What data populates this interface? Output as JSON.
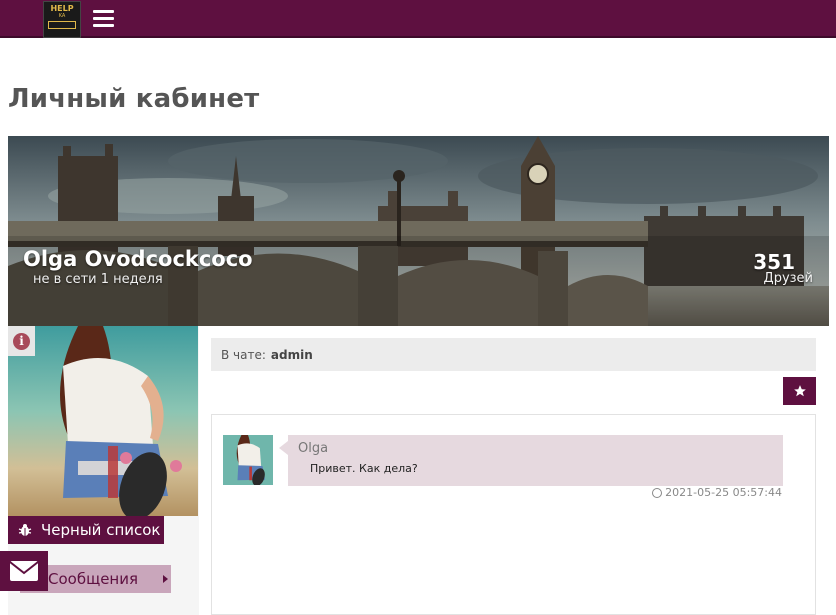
{
  "header": {
    "logo_line1": "HELP",
    "logo_line2": "KA",
    "menu_icon": "hamburger-icon"
  },
  "page": {
    "title": "Личный кабинет"
  },
  "profile": {
    "name": "Olga Ovodcockcoco",
    "status": "не в сети 1 неделя",
    "friends_count": "351",
    "friends_label": "Друзей"
  },
  "sidebar": {
    "info_icon": "info-icon",
    "info_glyph": "i",
    "blacklist_label": "Черный список",
    "blacklist_icon": "bug-icon",
    "messages_label": "Сообщения",
    "mail_icon": "envelope-icon"
  },
  "chat": {
    "in_chat_label": "В чате:",
    "in_chat_user": "admin",
    "favorite_icon": "star-icon",
    "messages": [
      {
        "author": "Olga",
        "text": "Привет. Как дела?",
        "time": "2021-05-25 05:57:44"
      }
    ]
  },
  "colors": {
    "brand": "#5e1040",
    "accent_light": "#c9a6bb",
    "bubble": "#e6d9df"
  }
}
